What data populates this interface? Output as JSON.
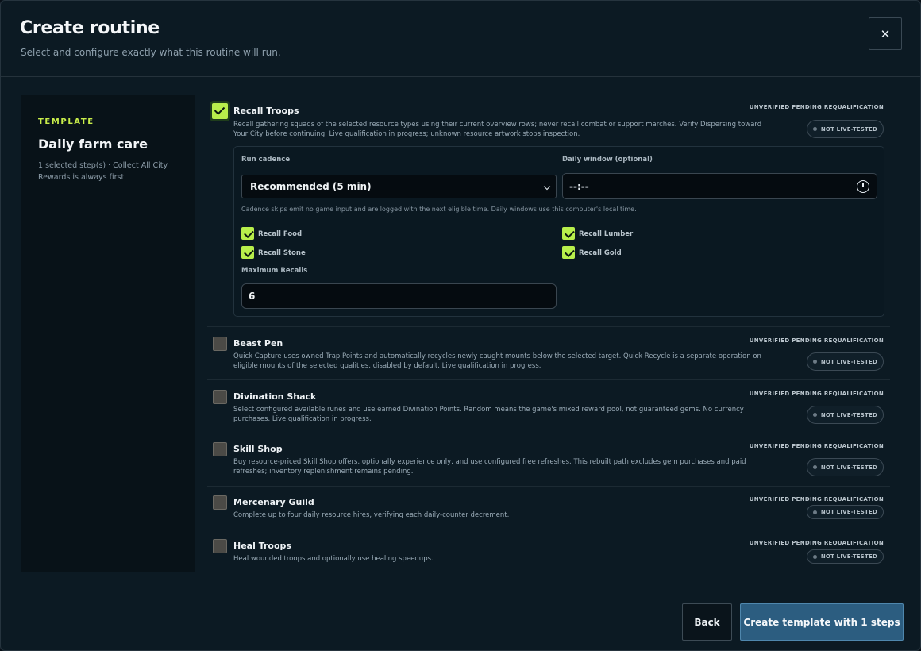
{
  "header": {
    "title": "Create routine",
    "subtitle": "Select and configure exactly what this routine will run.",
    "close_icon": "close-icon",
    "close_glyph": "✕"
  },
  "template": {
    "label": "TEMPLATE",
    "name": "Daily farm care",
    "note": "1 selected step(s) · Collect All City Rewards is always first"
  },
  "steps": [
    {
      "name": "Recall Troops",
      "checked": true,
      "description": "Recall gathering squads of the selected resource types using their current overview rows; never recall combat or support marches. Verify Dispersing toward Your City before continuing. Live qualification in progress; unknown resource artwork stops inspection.",
      "status": "UNVERIFIED PENDING REQUALIFICATION",
      "badge": "NOT LIVE-TESTED"
    },
    {
      "name": "Beast Pen",
      "checked": false,
      "description": "Quick Capture uses owned Trap Points and automatically recycles newly caught mounts below the selected target. Quick Recycle is a separate operation on eligible mounts of the selected qualities, disabled by default. Live qualification in progress.",
      "status": "UNVERIFIED PENDING REQUALIFICATION",
      "badge": "NOT LIVE-TESTED"
    },
    {
      "name": "Divination Shack",
      "checked": false,
      "description": "Select configured available runes and use earned Divination Points. Random means the game's mixed reward pool, not guaranteed gems. No currency purchases. Live qualification in progress.",
      "status": "UNVERIFIED PENDING REQUALIFICATION",
      "badge": "NOT LIVE-TESTED"
    },
    {
      "name": "Skill Shop",
      "checked": false,
      "description": "Buy resource-priced Skill Shop offers, optionally experience only, and use configured free refreshes. This rebuilt path excludes gem purchases and paid refreshes; inventory replenishment remains pending.",
      "status": "UNVERIFIED PENDING REQUALIFICATION",
      "badge": "NOT LIVE-TESTED"
    },
    {
      "name": "Mercenary Guild",
      "checked": false,
      "description": "Complete up to four daily resource hires, verifying each daily-counter decrement.",
      "status": "UNVERIFIED PENDING REQUALIFICATION",
      "badge": "NOT LIVE-TESTED"
    },
    {
      "name": "Heal Troops",
      "checked": false,
      "description": "Heal wounded troops and optionally use healing speedups.",
      "status": "UNVERIFIED PENDING REQUALIFICATION",
      "badge": "NOT LIVE-TESTED"
    }
  ],
  "recall_config": {
    "cadence_label": "Run cadence",
    "cadence_value": "Recommended (5 min)",
    "window_label": "Daily window (optional)",
    "window_value": "--:--",
    "hint": "Cadence skips emit no game input and are logged with the next eligible time. Daily windows use this computer's local time.",
    "options": [
      {
        "label": "Recall Food",
        "checked": true
      },
      {
        "label": "Recall Lumber",
        "checked": true
      },
      {
        "label": "Recall Stone",
        "checked": true
      },
      {
        "label": "Recall Gold",
        "checked": true
      }
    ],
    "max_label": "Maximum Recalls",
    "max_value": "6"
  },
  "footer": {
    "back_label": "Back",
    "create_label": "Create template with 1 steps"
  },
  "colors": {
    "accent_green": "#b8ef4b",
    "primary_button": "#2c5d80",
    "background": "#0c1a23"
  }
}
